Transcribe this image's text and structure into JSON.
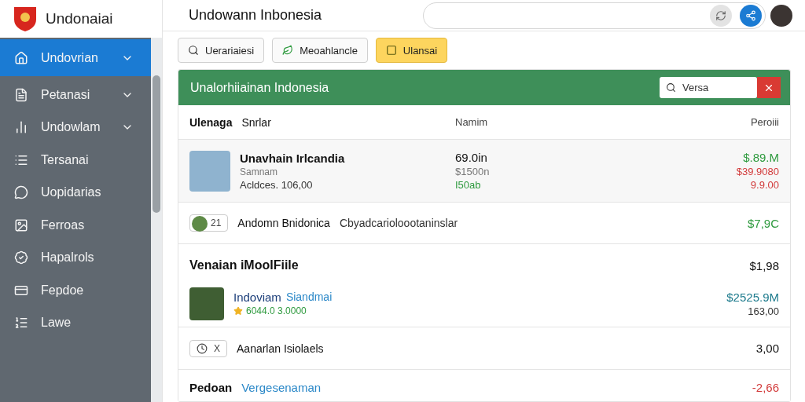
{
  "brand": {
    "name": "Undonaiai"
  },
  "header": {
    "title": "Undowann Inbonesia"
  },
  "sidebar": {
    "items": [
      {
        "label": "Undovrian",
        "selected": true,
        "expandable": true
      },
      {
        "label": "Petanasi",
        "selected": false,
        "expandable": true
      },
      {
        "label": "Undowlam",
        "selected": false,
        "expandable": true
      },
      {
        "label": "Tersanai",
        "selected": false,
        "expandable": false
      },
      {
        "label": "Uopidarias",
        "selected": false,
        "expandable": false
      },
      {
        "label": "Ferroas",
        "selected": false,
        "expandable": false
      },
      {
        "label": "Hapalrols",
        "selected": false,
        "expandable": false
      },
      {
        "label": "Fepdoe",
        "selected": false,
        "expandable": false
      },
      {
        "label": "Lawe",
        "selected": false,
        "expandable": false
      }
    ]
  },
  "toolbar": [
    {
      "label": "Uerariaiesi",
      "selected": false
    },
    {
      "label": "Meoahlancle",
      "selected": false
    },
    {
      "label": "Ulansai",
      "selected": true
    }
  ],
  "panel": {
    "title": "Unalorhiiainan Indonesia",
    "search": {
      "value": "Versa"
    },
    "columns": {
      "column_1": "Ulenaga",
      "column_1_sub": "Snrlar",
      "column_2": "Namim",
      "column_3": "Peroiii"
    },
    "rows": [
      {
        "kind": "profile",
        "title": "Unavhain Irlcandia",
        "line_2": "Samnam",
        "line_3": "Acldces. 106,00",
        "mid": [
          {
            "text": "69.0in",
            "color": "#111111"
          },
          {
            "text": "$1500n",
            "color": "#777777"
          },
          {
            "text": "I50ab",
            "color": "#2e9a3e"
          }
        ],
        "values": [
          {
            "text": "$.89.M",
            "color": "#2e9a3e"
          },
          {
            "text": "$39.9080",
            "color": "#d23a3a"
          },
          {
            "text": "9.9.00",
            "color": "#d23a3a"
          }
        ]
      },
      {
        "kind": "tag",
        "badge": "21",
        "title": "Andomn Bnidonica",
        "desc": "Cbyadcarioloootaninslar",
        "values": [
          {
            "text": "$7,9C",
            "color": "#2e9a3e"
          }
        ]
      },
      {
        "kind": "section",
        "title": "Venaian iMooIFiile",
        "values": [
          {
            "text": "$1,98",
            "color": "#111111"
          }
        ]
      },
      {
        "kind": "media",
        "title": "Indoviam",
        "link": "Siandmai",
        "rating": "6044.0 3.0000",
        "values": [
          {
            "text": "$2525.9M",
            "color": "#1c7a8c"
          },
          {
            "text": "163,00",
            "color": "#333333"
          }
        ]
      },
      {
        "kind": "chip",
        "chip": "X",
        "title": "Aanarlan Isiolaels",
        "values": [
          {
            "text": "3,00",
            "color": "#111111"
          }
        ]
      },
      {
        "kind": "cut",
        "title": "Pedoan",
        "link": "Vergesenaman",
        "values": [
          {
            "text": "-2,66",
            "color": "#d23a3a"
          }
        ]
      }
    ]
  }
}
